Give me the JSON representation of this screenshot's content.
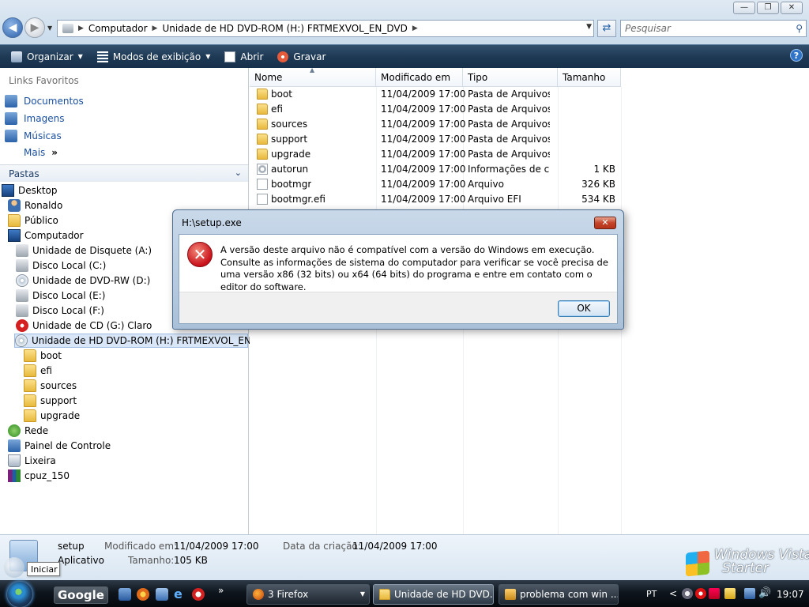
{
  "window": {
    "controls": [
      "—",
      "❐",
      "✕"
    ]
  },
  "address": {
    "crumbs": [
      "Computador",
      "Unidade de HD DVD-ROM (H:) FRTMEXVOL_EN_DVD"
    ],
    "search_placeholder": "Pesquisar"
  },
  "toolbar": {
    "organizar": "Organizar",
    "modos": "Modos de exibição",
    "abrir": "Abrir",
    "gravar": "Gravar",
    "help": "?"
  },
  "nav": {
    "favorites_header": "Links Favoritos",
    "favorites": [
      "Documentos",
      "Imagens",
      "Músicas",
      "Mais"
    ],
    "mais_arrow": "»",
    "pastas": "Pastas",
    "tree": [
      {
        "label": "Desktop",
        "icon": "desktop-icon"
      },
      {
        "label": "Ronaldo",
        "icon": "user-folder-icon"
      },
      {
        "label": "Público",
        "icon": "folder-icon"
      },
      {
        "label": "Computador",
        "icon": "computer-icon"
      },
      {
        "label": "Unidade de Disquete (A:)",
        "icon": "floppy-icon"
      },
      {
        "label": "Disco Local (C:)",
        "icon": "hard-disk-icon"
      },
      {
        "label": "Unidade de DVD-RW (D:)",
        "icon": "dvd-drive-icon"
      },
      {
        "label": "Disco Local (E:)",
        "icon": "hard-disk-icon"
      },
      {
        "label": "Disco Local (F:)",
        "icon": "hard-disk-icon"
      },
      {
        "label": "Unidade de CD (G:) Claro",
        "icon": "cd-icon"
      },
      {
        "label": "Unidade de HD DVD-ROM (H:) FRTMEXVOL_EN_DV",
        "icon": "dvd-icon"
      },
      {
        "label": "boot",
        "icon": "folder-icon"
      },
      {
        "label": "efi",
        "icon": "folder-icon"
      },
      {
        "label": "sources",
        "icon": "folder-icon"
      },
      {
        "label": "support",
        "icon": "folder-icon"
      },
      {
        "label": "upgrade",
        "icon": "folder-icon"
      },
      {
        "label": "Rede",
        "icon": "network-icon"
      },
      {
        "label": "Painel de Controle",
        "icon": "control-panel-icon"
      },
      {
        "label": "Lixeira",
        "icon": "recycle-bin-icon"
      },
      {
        "label": "cpuz_150",
        "icon": "archive-icon"
      }
    ]
  },
  "files": {
    "columns": [
      "Nome",
      "Modificado em",
      "Tipo",
      "Tamanho"
    ],
    "rows": [
      {
        "name": "boot",
        "date": "11/04/2009 17:00",
        "type": "Pasta de Arquivos",
        "size": "",
        "icon": "folder-icon"
      },
      {
        "name": "efi",
        "date": "11/04/2009 17:00",
        "type": "Pasta de Arquivos",
        "size": "",
        "icon": "folder-icon"
      },
      {
        "name": "sources",
        "date": "11/04/2009 17:00",
        "type": "Pasta de Arquivos",
        "size": "",
        "icon": "folder-icon"
      },
      {
        "name": "support",
        "date": "11/04/2009 17:00",
        "type": "Pasta de Arquivos",
        "size": "",
        "icon": "folder-icon"
      },
      {
        "name": "upgrade",
        "date": "11/04/2009 17:00",
        "type": "Pasta de Arquivos",
        "size": "",
        "icon": "folder-icon"
      },
      {
        "name": "autorun",
        "date": "11/04/2009 17:00",
        "type": "Informações de c...",
        "size": "1 KB",
        "icon": "settings-file-icon"
      },
      {
        "name": "bootmgr",
        "date": "11/04/2009 17:00",
        "type": "Arquivo",
        "size": "326 KB",
        "icon": "file-icon"
      },
      {
        "name": "bootmgr.efi",
        "date": "11/04/2009 17:00",
        "type": "Arquivo EFI",
        "size": "534 KB",
        "icon": "file-icon"
      }
    ]
  },
  "details": {
    "name": "setup",
    "kind": "Aplicativo",
    "modified_label": "Modificado em:",
    "modified_value": "11/04/2009 17:00",
    "created_label": "Data da criação:",
    "created_value": "11/04/2009 17:00",
    "size_label": "Tamanho:",
    "size_value": "105 KB",
    "tooltip": "Iniciar",
    "brand_line1": "Windows Vista",
    "brand_line2": "Starter"
  },
  "dialog": {
    "title": "H:\\setup.exe",
    "message": "A versão deste arquivo não é compatível com a versão do Windows em execução. Consulte as informações de sistema do computador para verificar se você precisa de uma versão x86 (32 bits) ou x64 (64 bits) do programa e entre em contato com o editor do software.",
    "ok": "OK",
    "close": "✕"
  },
  "taskbar": {
    "google": "Google",
    "buttons": [
      "3 Firefox",
      "Unidade de HD DVD...",
      "problema com win ..."
    ],
    "language": "PT",
    "clock": "19:07",
    "more": "»",
    "tray_expand": "<"
  }
}
